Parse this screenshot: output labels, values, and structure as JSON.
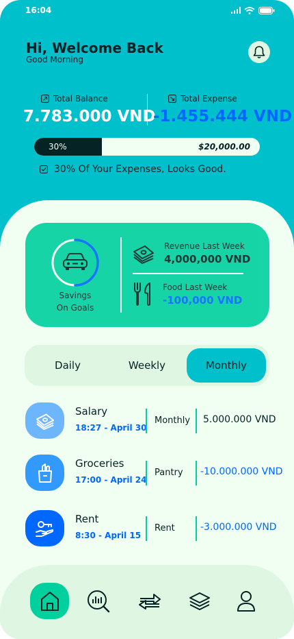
{
  "status_bar": {
    "time": "16:04"
  },
  "header": {
    "title": "Hi, Welcome Back",
    "subtitle": "Good Morning"
  },
  "balance": {
    "total_balance_label": "Total Balance",
    "total_balance_value": "7.783.000 VND",
    "total_expense_label": "Total Expense",
    "total_expense_value": "-1.455.444 VND"
  },
  "progress": {
    "percent_label": "30%",
    "fraction": 0.3,
    "target": "$20,000.00"
  },
  "expense_note": "30% Of Your Expenses, Looks Good.",
  "goals": {
    "savings_label_line1": "Savings",
    "savings_label_line2": "On Goals",
    "revenue_label": "Revenue Last Week",
    "revenue_value": "4,000,000 VND",
    "food_label": "Food Last Week",
    "food_value": "-100,000 VND"
  },
  "tabs": [
    {
      "label": "Daily"
    },
    {
      "label": "Weekly"
    },
    {
      "label": "Monthly",
      "active": true
    }
  ],
  "transactions": [
    {
      "title": "Salary",
      "time": "18:27 - April 30",
      "category": "Monthly",
      "amount": "5.000.000 VND",
      "icon": "money-stack-icon",
      "color": "#6DB6FE"
    },
    {
      "title": "Groceries",
      "time": "17:00 - April 24",
      "category": "Pantry",
      "amount": "-10.000.000 VND",
      "icon": "grocery-bag-icon",
      "color": "#3299FF"
    },
    {
      "title": "Rent",
      "time": "8:30 - April 15",
      "category": "Rent",
      "amount": "-3.000.000 VND",
      "icon": "key-hand-icon",
      "color": "#0068FF"
    }
  ],
  "bottom_nav": [
    "home-icon",
    "analysis-icon",
    "transfer-icon",
    "layers-icon",
    "profile-icon"
  ],
  "colors": {
    "primary": "#00C0CC",
    "accent": "#00D09E",
    "blue": "#0068FF",
    "dark": "#052224",
    "light": "#F1FFF3"
  }
}
